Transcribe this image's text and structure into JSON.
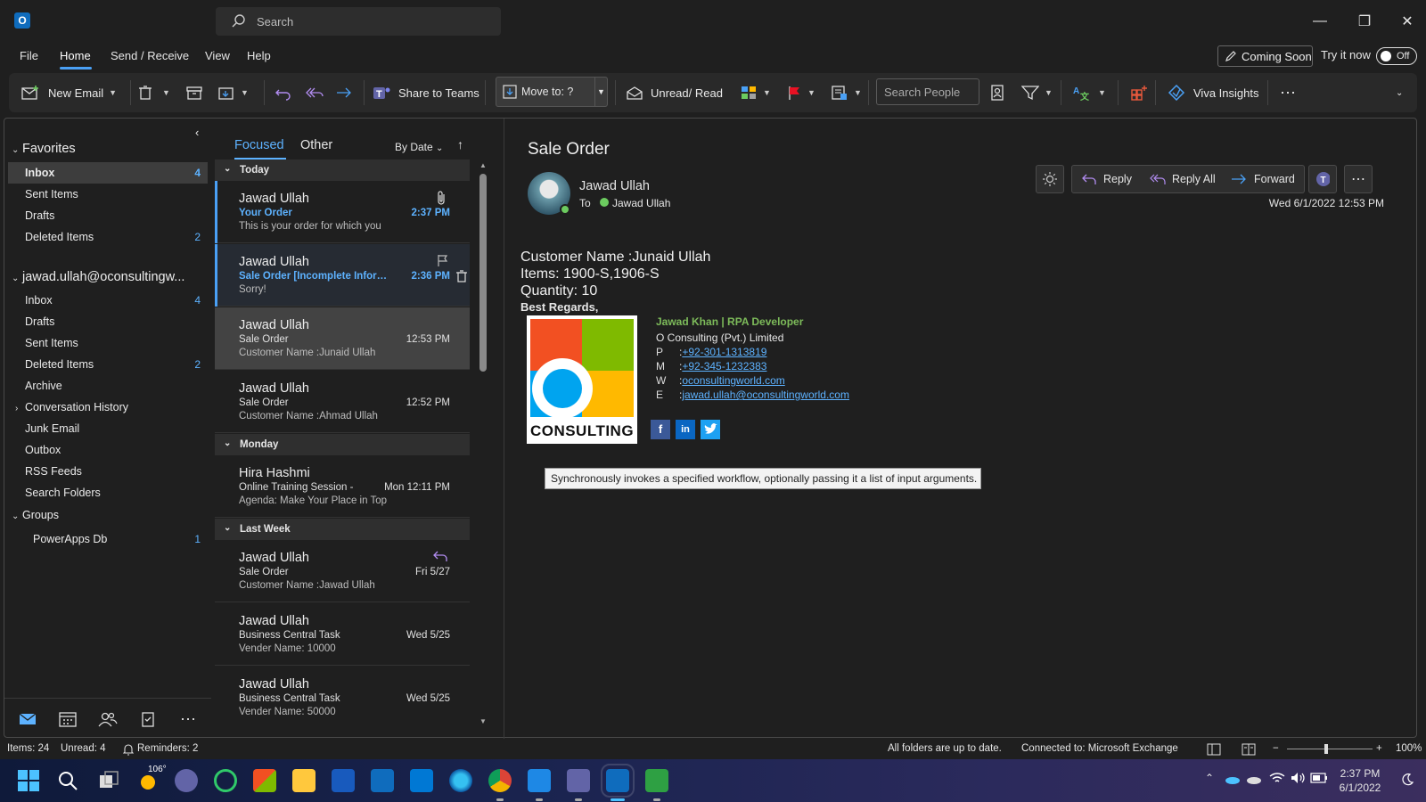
{
  "titlebar": {
    "app_icon": "outlook-icon",
    "search_placeholder": "Search"
  },
  "menu": {
    "items": [
      "File",
      "Home",
      "Send / Receive",
      "View",
      "Help"
    ],
    "active": "Home",
    "coming_soon": "Coming Soon",
    "try_it_now": "Try it now",
    "toggle_state": "Off"
  },
  "ribbon": {
    "new_email": "New Email",
    "share_to_teams": "Share to Teams",
    "move_to": "Move to: ?",
    "unread_read": "Unread/ Read",
    "search_people_placeholder": "Search People",
    "viva_insights": "Viva Insights"
  },
  "folders": {
    "favorites_header": "Favorites",
    "favorites": [
      {
        "label": "Inbox",
        "count": "4",
        "selected": true
      },
      {
        "label": "Sent Items",
        "count": ""
      },
      {
        "label": "Drafts",
        "count": ""
      },
      {
        "label": "Deleted Items",
        "count": "2"
      }
    ],
    "account_header": "jawad.ullah@oconsultingw...",
    "account": [
      {
        "label": "Inbox",
        "count": "4"
      },
      {
        "label": "Drafts",
        "count": ""
      },
      {
        "label": "Sent Items",
        "count": ""
      },
      {
        "label": "Deleted Items",
        "count": "2"
      },
      {
        "label": "Archive",
        "count": ""
      },
      {
        "label": "Conversation History",
        "count": "",
        "collapsed": true
      },
      {
        "label": "Junk Email",
        "count": ""
      },
      {
        "label": "Outbox",
        "count": ""
      },
      {
        "label": "RSS Feeds",
        "count": ""
      },
      {
        "label": "Search Folders",
        "count": ""
      }
    ],
    "groups_header": "Groups",
    "groups": [
      {
        "label": "PowerApps Db",
        "count": "1"
      }
    ]
  },
  "list": {
    "tabs": {
      "focused": "Focused",
      "other": "Other"
    },
    "sort": "By Date",
    "groups": {
      "today": "Today",
      "monday": "Monday",
      "last_week": "Last Week"
    },
    "messages": [
      {
        "from": "Jawad Ullah",
        "subject": "Your Order",
        "preview": "This is your order for which you",
        "time": "2:37 PM"
      },
      {
        "from": "Jawad Ullah",
        "subject": "Sale Order [Incomplete Inform...",
        "preview": "Sorry!",
        "time": "2:36 PM"
      },
      {
        "from": "Jawad Ullah",
        "subject": "Sale Order",
        "preview": "Customer Name :Junaid Ullah",
        "time": "12:53 PM"
      },
      {
        "from": "Jawad Ullah",
        "subject": "Sale Order",
        "preview": "Customer Name :Ahmad Ullah",
        "time": "12:52 PM"
      },
      {
        "from": "Hira Hashmi",
        "subject": "Online Training Session -",
        "preview": "Agenda: Make Your Place in Top",
        "time": "Mon 12:11 PM"
      },
      {
        "from": "Jawad Ullah",
        "subject": "Sale Order",
        "preview": "Customer Name :Jawad Ullah",
        "time": "Fri 5/27"
      },
      {
        "from": "Jawad Ullah",
        "subject": "Business Central Task",
        "preview": "Vender Name: 10000",
        "time": "Wed 5/25"
      },
      {
        "from": "Jawad Ullah",
        "subject": "Business Central Task",
        "preview": "Vender Name: 50000",
        "time": "Wed 5/25"
      }
    ]
  },
  "reading": {
    "subject": "Sale Order",
    "from": "Jawad Ullah",
    "to_label": "To",
    "to": "Jawad Ullah",
    "date": "Wed 6/1/2022 12:53 PM",
    "actions": {
      "reply": "Reply",
      "reply_all": "Reply All",
      "forward": "Forward"
    },
    "body": {
      "customer": "Customer Name :Junaid Ullah",
      "items": "Items: 1900-S,1906-S",
      "quantity": "Quantity: 10",
      "regards": "Best Regards,"
    },
    "logo_text": "CONSULTING",
    "signature": {
      "name": "Jawad Khan | RPA Developer",
      "company": "O Consulting (Pvt.) Limited",
      "p_key": "P",
      "p": "+92-301-1313819",
      "m_key": "M",
      "m": "+92-345-1232383",
      "w_key": "W",
      "w": "oconsultingworld.com",
      "e_key": "E",
      "e": "jawad.ullah@oconsultingworld.com"
    },
    "tooltip": "Synchronously invokes a specified workflow, optionally passing it a list of input arguments."
  },
  "status": {
    "items": "Items: 24",
    "unread": "Unread: 4",
    "reminders": "Reminders: 2",
    "sync": "All folders are up to date.",
    "connection": "Connected to: Microsoft Exchange",
    "zoom": "100%"
  },
  "taskbar": {
    "weather": "106°",
    "time": "2:37 PM",
    "date": "6/1/2022"
  },
  "colors": {
    "accent": "#4aa0f5",
    "link": "#5db2ff",
    "flag": "#e81123",
    "presence": "#6ccb5f"
  }
}
